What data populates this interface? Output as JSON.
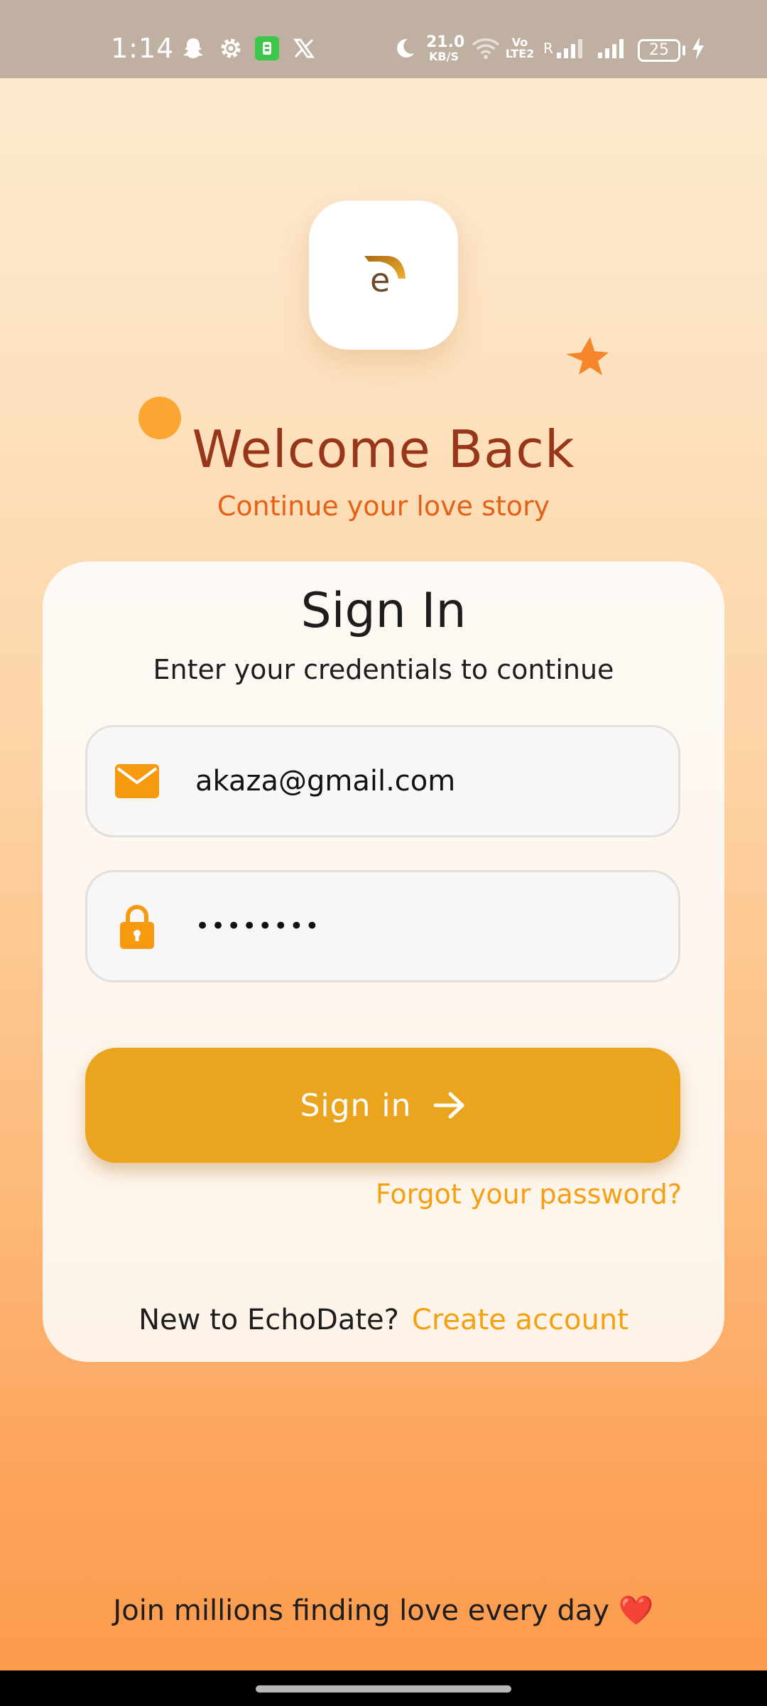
{
  "status_bar": {
    "time": "1:14",
    "net_speed_value": "21.0",
    "net_speed_unit": "KB/S",
    "volte_label": "Vo LTE2",
    "roaming_label": "R",
    "battery_level": "25",
    "icons": [
      "snapchat-icon",
      "settings-icon",
      "app-notification-icon",
      "x-icon",
      "moon-icon",
      "wifi-icon",
      "signal-icon",
      "signal-icon",
      "charging-icon"
    ]
  },
  "hero": {
    "logo_letter": "e",
    "title": "Welcome Back",
    "subtitle": "Continue your love story"
  },
  "card": {
    "title": "Sign In",
    "subtitle": "Enter your credentials to continue",
    "email_value": "akaza@gmail.com",
    "password_value": "••••••••",
    "signin_label": "Sign in",
    "forgot_label": "Forgot your password?",
    "signup_prompt": "New to EchoDate?",
    "signup_link": "Create account"
  },
  "footer": {
    "tagline": "Join millions finding love every day ❤️"
  },
  "colors": {
    "accent": "#eba41e",
    "link": "#f5a012",
    "title": "#98361a",
    "subtitle": "#e46117"
  }
}
